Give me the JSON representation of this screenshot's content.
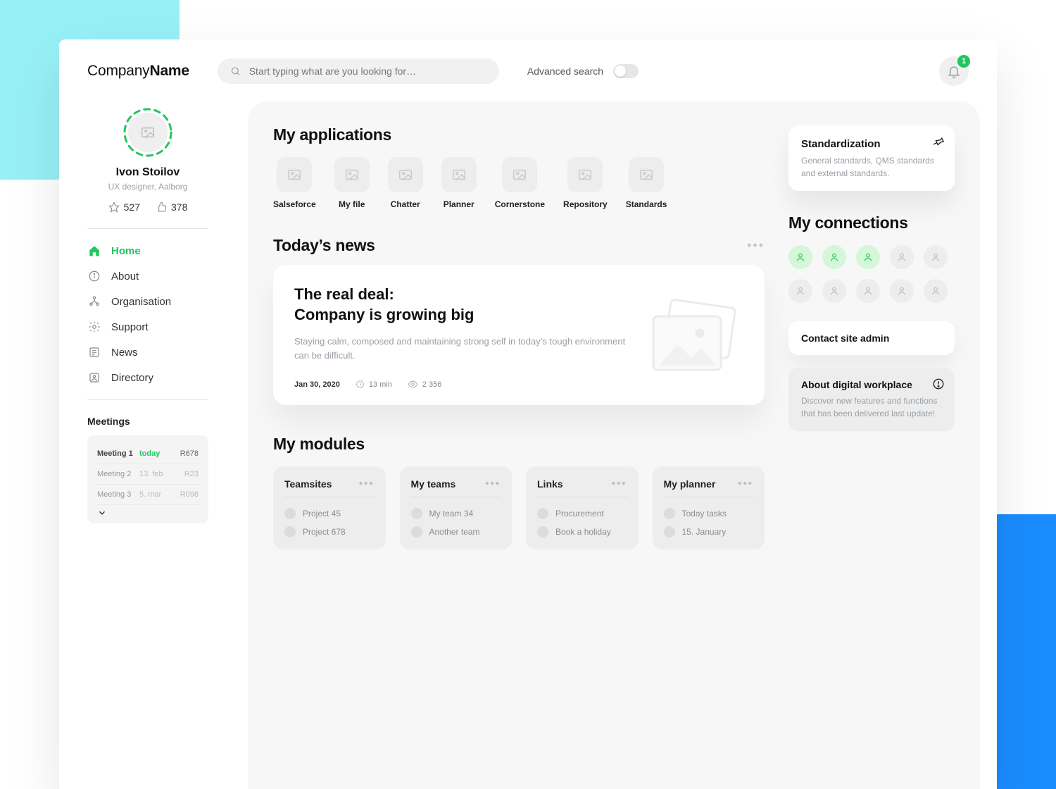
{
  "brand": {
    "prefix": "Company",
    "bold": "Name"
  },
  "search": {
    "placeholder": "Start typing what are you looking for…"
  },
  "advanced_label": "Advanced search",
  "notifications": {
    "count": "1"
  },
  "profile": {
    "name": "Ivon Stoilov",
    "role": "UX designer, Aalborg",
    "stars": "527",
    "likes": "378"
  },
  "nav": [
    {
      "label": "Home",
      "icon": "home"
    },
    {
      "label": "About",
      "icon": "info"
    },
    {
      "label": "Organisation",
      "icon": "org"
    },
    {
      "label": "Support",
      "icon": "gear"
    },
    {
      "label": "News",
      "icon": "news"
    },
    {
      "label": "Directory",
      "icon": "user"
    }
  ],
  "meetings": {
    "title": "Meetings",
    "rows": [
      {
        "name": "Meeting 1",
        "date": "today",
        "room": "R678"
      },
      {
        "name": "Meeting 2",
        "date": "13. feb",
        "room": "R23"
      },
      {
        "name": "Meeting 3",
        "date": "5. mar",
        "room": "R098"
      }
    ]
  },
  "sections": {
    "applications": "My applications",
    "news": "Today’s news",
    "modules": "My modules",
    "connections": "My connections"
  },
  "apps": [
    {
      "label": "Salseforce"
    },
    {
      "label": "My file"
    },
    {
      "label": "Chatter"
    },
    {
      "label": "Planner"
    },
    {
      "label": "Cornerstone"
    },
    {
      "label": "Repository"
    },
    {
      "label": "Standards"
    }
  ],
  "news_card": {
    "title_line1": "The real deal:",
    "title_line2": "Company is growing big",
    "summary": "Staying calm, composed and maintaining strong self in today’s tough environment can be difficult.",
    "date": "Jan 30, 2020",
    "read_time": "13 min",
    "views": "2 356"
  },
  "modules": [
    {
      "title": "Teamsites",
      "items": [
        "Project 45",
        "Project 678"
      ]
    },
    {
      "title": "My teams",
      "items": [
        "My team 34",
        "Another team"
      ]
    },
    {
      "title": "Links",
      "items": [
        "Procurement",
        "Book a holiday"
      ]
    },
    {
      "title": "My planner",
      "items": [
        "Today tasks",
        "15. January"
      ]
    }
  ],
  "pin_card": {
    "title": "Standardization",
    "subtitle": "General standards, QMS standards and external standards."
  },
  "connections": {
    "online": [
      true,
      true,
      true,
      false,
      false,
      false,
      false,
      false,
      false,
      false
    ]
  },
  "cta": "Contact site admin",
  "about_card": {
    "title": "About digital workplace",
    "subtitle": "Discover new features and functions that has been delivered last update!"
  },
  "colors": {
    "accent_green": "#22c55e",
    "accent_cyan": "#98f0f7",
    "accent_blue": "#1a8cff"
  }
}
